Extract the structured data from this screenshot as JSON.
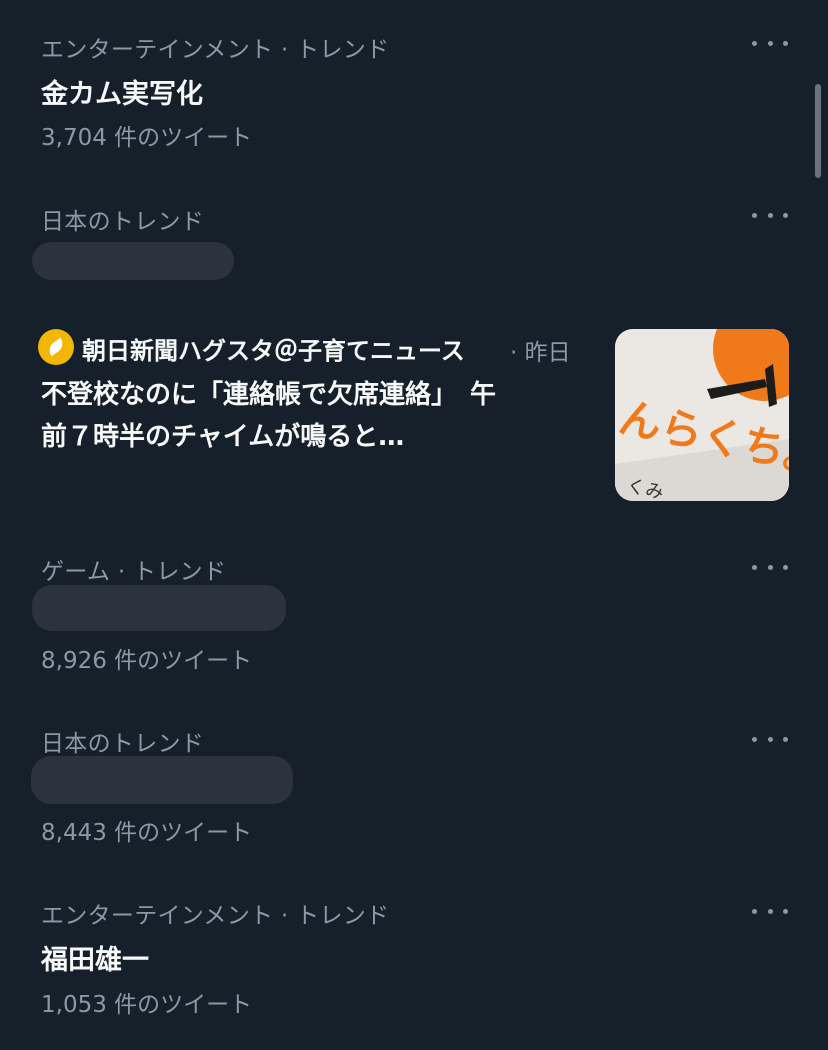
{
  "trends": [
    {
      "category": "エンターテインメント · トレンド",
      "title": "金カム実写化",
      "count": "3,704 件のツイート"
    },
    {
      "category": "日本のトレンド",
      "title_hidden": true
    },
    {
      "category": "ゲーム · トレンド",
      "title_hidden": true,
      "count": "8,926 件のツイート"
    },
    {
      "category": "日本のトレンド",
      "title_hidden": true,
      "count": "8,443 件のツイート"
    },
    {
      "category": "エンターテインメント · トレンド",
      "title": "福田雄一",
      "count": "1,053 件のツイート"
    }
  ],
  "news": {
    "source": "朝日新聞ハグスタ＠子育てニュース",
    "time": "· 昨日",
    "headline_line1": "不登校なのに「連絡帳で欠席連絡」　午",
    "headline_line2": "前７時半のチャイムが鳴ると…",
    "thumbnail_text": "んらくち。",
    "thumbnail_small": "くみ",
    "source_icon": "asahi-hagusuta-logo-icon"
  },
  "icons": {
    "more": "more-horizontal-icon"
  },
  "colors": {
    "background": "#15202b",
    "text_primary": "#f7f9f9",
    "text_secondary": "#8b98a5",
    "redaction": "#2b343d",
    "thumb_orange": "#f07a1a"
  }
}
